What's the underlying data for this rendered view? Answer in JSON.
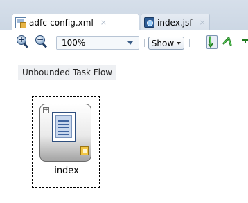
{
  "tabs": [
    {
      "label": "adfc-config.xml",
      "close": "×",
      "icon": "xml-file-icon",
      "active": true
    },
    {
      "label": "index.jsf",
      "close": "×",
      "icon": "jsf-file-icon",
      "active": false
    }
  ],
  "toolbar": {
    "zoom_in_symbol": "+",
    "zoom_out_symbol": "−",
    "zoom_value": "100%",
    "show_label": "Show",
    "tools": [
      "control-flow-case-icon",
      "wildcard-control-flow-icon"
    ]
  },
  "diagram": {
    "flow_label": "Unbounded Task Flow",
    "expand_symbol": "+",
    "activities": [
      {
        "name": "index",
        "icon": "view-page-icon",
        "badge": "default-activity-icon"
      }
    ]
  },
  "colors": {
    "tab_strip": "#d6dfea",
    "page_icon_border": "#2f4f7e",
    "control_flow_green": "#2e9a2e"
  }
}
